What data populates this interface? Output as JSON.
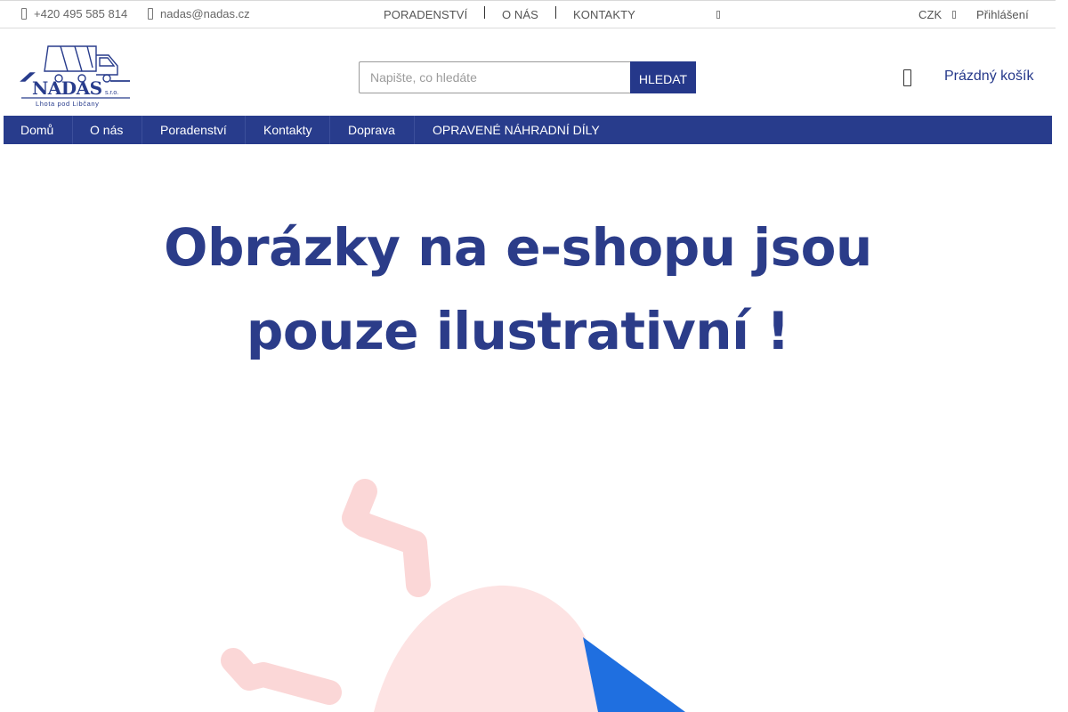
{
  "topbar": {
    "phone": "+420 495 585 814",
    "email": "nadas@nadas.cz",
    "links": [
      "PORADENSTVÍ",
      "O NÁS",
      "KONTAKTY"
    ],
    "currency": "CZK",
    "login": "Přihlášení"
  },
  "logo": {
    "name": "NADAS",
    "suffix": "s.r.o.",
    "tagline": "Lhota pod Libčany"
  },
  "search": {
    "placeholder": "Napište, co hledáte",
    "value": "",
    "button_label": "HLEDAT"
  },
  "cart": {
    "label": "Prázdný košík"
  },
  "nav": {
    "items": [
      "Domů",
      "O nás",
      "Poradenství",
      "Kontakty",
      "Doprava",
      "OPRAVENÉ NÁHRADNÍ DÍLY"
    ]
  },
  "banner": {
    "line1": "Obrázky na e-shopu jsou",
    "line2": "pouze  ilustrativní !"
  },
  "colors": {
    "brand": "#283c8c",
    "banner_text": "#2b3c89",
    "illustration_pink": "#fde3e3",
    "illustration_blue": "#1f6fe0"
  }
}
